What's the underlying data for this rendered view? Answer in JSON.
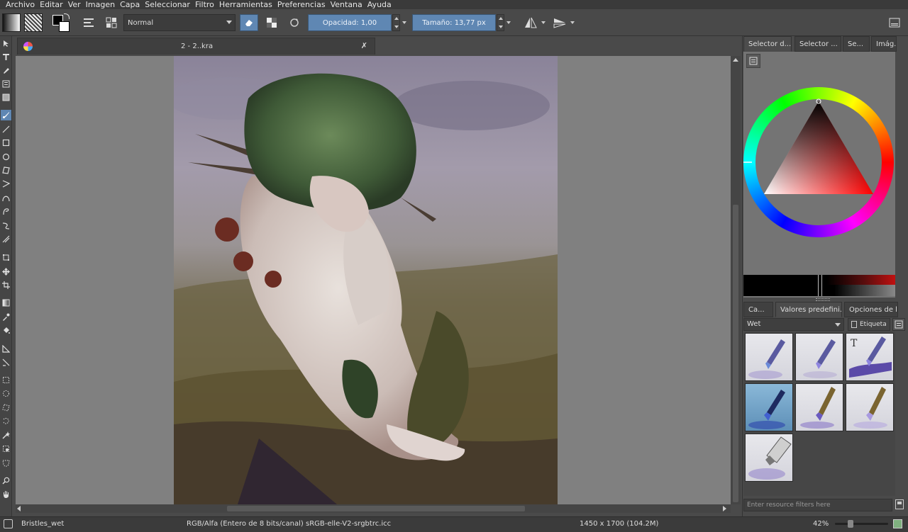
{
  "menu": [
    "Archivo",
    "Editar",
    "Ver",
    "Imagen",
    "Capa",
    "Seleccionar",
    "Filtro",
    "Herramientas",
    "Preferencias",
    "Ventana",
    "Ayuda"
  ],
  "toolbar": {
    "blend_mode": "Normal",
    "opacity_label": "Opacidad:  1,00",
    "size_label": "Tamaño:  13,77 px"
  },
  "document": {
    "tab_title": "2 - 2..kra",
    "close_glyph": "✗"
  },
  "docker": {
    "top_tabs": [
      "Selector d...",
      "Selector ...",
      "Se...",
      "Imág..."
    ],
    "bottom_tabs": [
      "Ca...",
      "Valores predefini...",
      "Opciones de la ..."
    ],
    "tag_select": "Wet",
    "tag_button": "Etiqueta",
    "filter_placeholder": "Enter resource filters here"
  },
  "status": {
    "preset_name": "Bristles_wet",
    "color_space": "RGB/Alfa (Entero de 8 bits/canal)  sRGB-elle-V2-srgbtrc.icc",
    "dimensions": "1450 x 1700 (104.2M)",
    "zoom": "42%"
  },
  "colors": {
    "accent": "#5f87b3",
    "canvas_bg": "#808080",
    "panel_bg": "#4a4a4a",
    "menubar_bg": "#3a3a3a",
    "selected_color": "#e01010"
  }
}
